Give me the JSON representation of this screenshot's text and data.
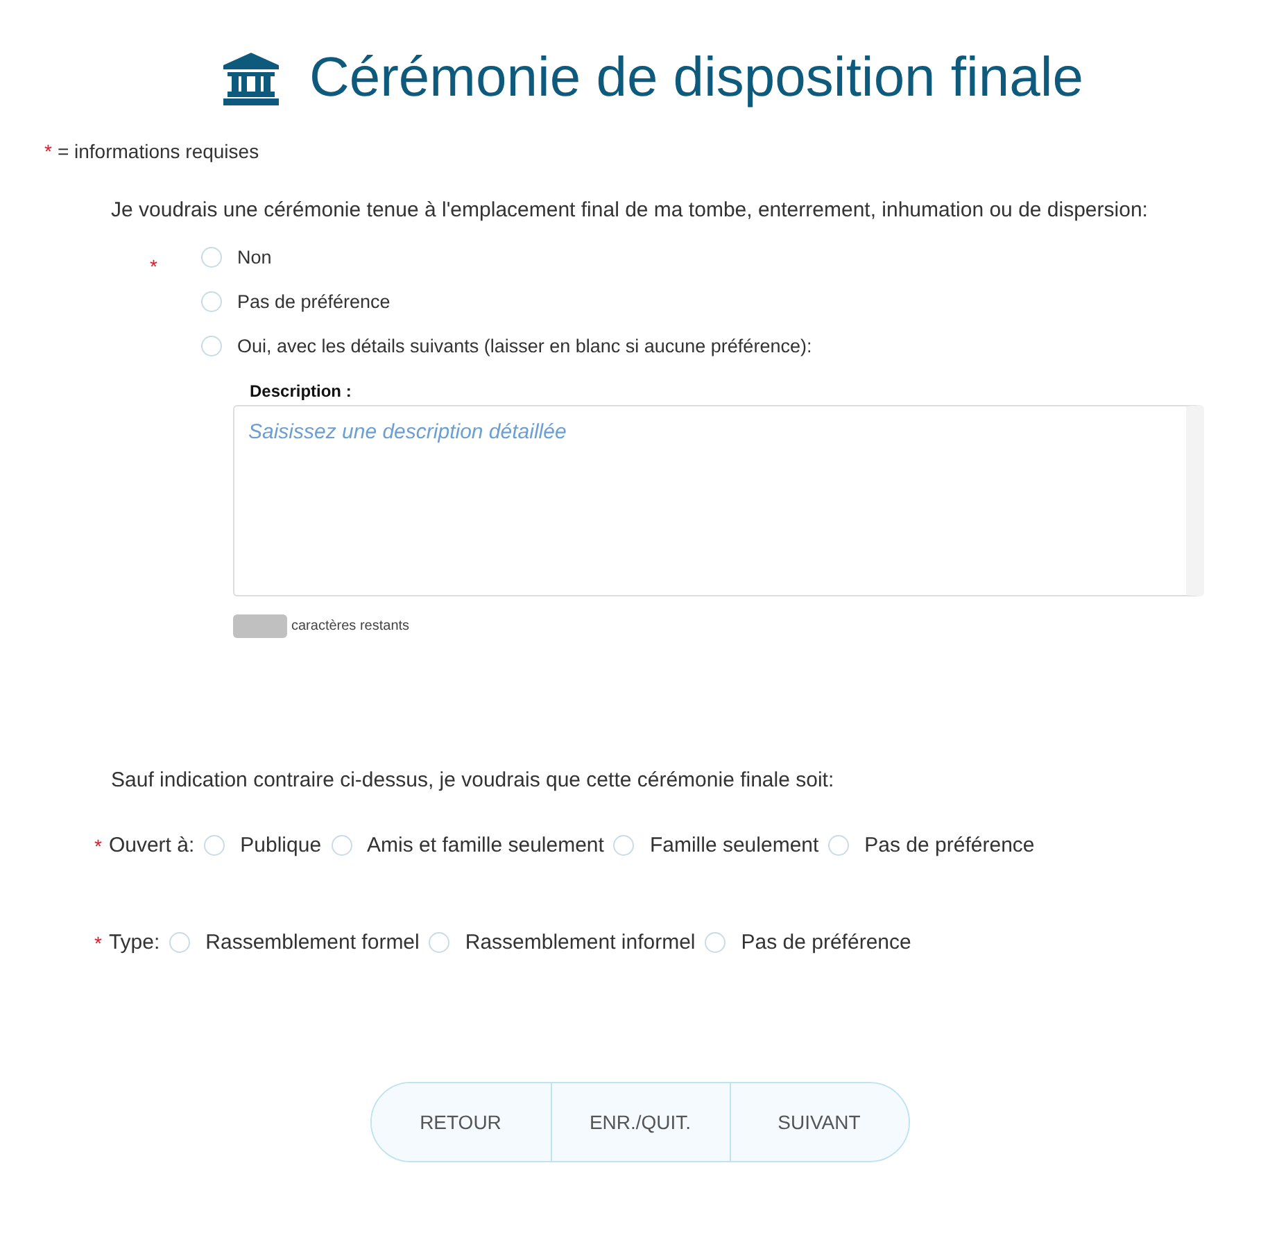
{
  "title": "Cérémonie de disposition finale",
  "required_note": {
    "mark": "*",
    "text": "= informations requises"
  },
  "question": {
    "text": "Je voudrais une cérémonie tenue à l'emplacement final de ma tombe, enterrement, inhumation ou de dispersion:",
    "required_mark": "*",
    "options": [
      {
        "label": "Non",
        "selected": false
      },
      {
        "label": "Pas de préférence",
        "selected": false
      },
      {
        "label": "Oui, avec les détails suivants (laisser en blanc si aucune préférence):",
        "selected": false
      }
    ]
  },
  "description": {
    "label": "Description :",
    "placeholder": "Saisissez une description détaillée",
    "counter_label": "caractères restants"
  },
  "sentence": "Sauf indication contraire ci-dessus, je voudrais que cette cérémonie finale soit:",
  "groups": [
    {
      "required_mark": "*",
      "label": "Ouvert à:",
      "options": [
        {
          "label": "Publique",
          "selected": false
        },
        {
          "label": "Amis et famille seulement",
          "selected": false
        },
        {
          "label": "Famille seulement",
          "selected": false
        },
        {
          "label": "Pas de préférence",
          "selected": false
        }
      ]
    },
    {
      "required_mark": "*",
      "label": "Type:",
      "options": [
        {
          "label": "Rassemblement formel",
          "selected": false
        },
        {
          "label": "Rassemblement informel",
          "selected": false
        },
        {
          "label": "Pas de préférence",
          "selected": false
        }
      ]
    }
  ],
  "buttons": [
    "RETOUR",
    "ENR./QUIT.",
    "SUIVANT"
  ]
}
